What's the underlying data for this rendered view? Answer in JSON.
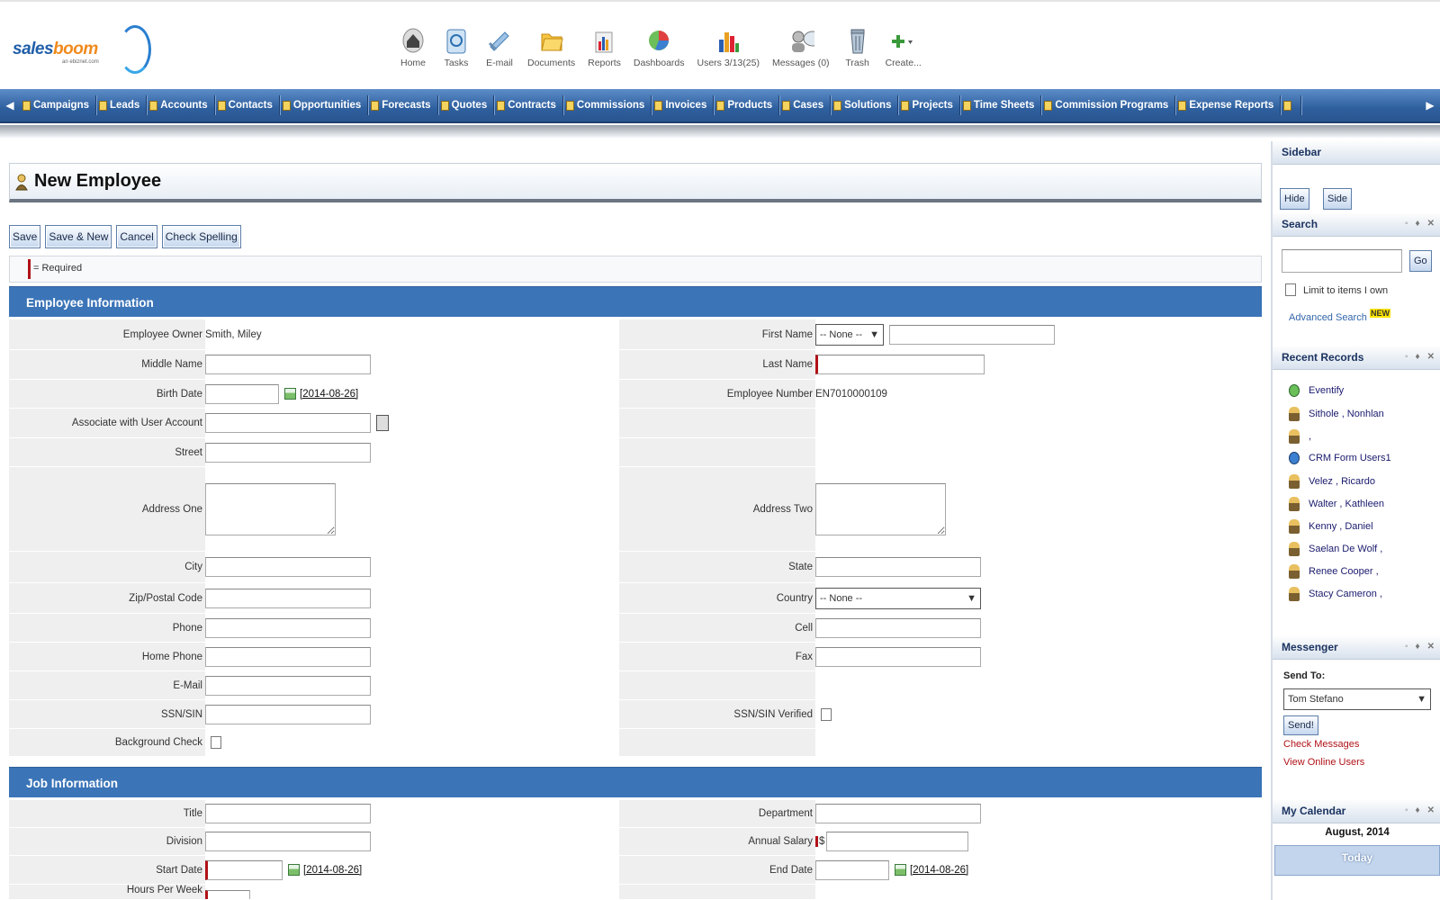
{
  "app": {
    "logo_main": "sales",
    "logo_accent": "boom",
    "logo_tagline": "an ebiznet.com"
  },
  "top_icons": [
    {
      "label": "Home",
      "icon": "home-icon"
    },
    {
      "label": "Tasks",
      "icon": "tasks-icon"
    },
    {
      "label": "E-mail",
      "icon": "email-icon"
    },
    {
      "label": "Documents",
      "icon": "folder-icon"
    },
    {
      "label": "Reports",
      "icon": "reports-icon"
    },
    {
      "label": "Dashboards",
      "icon": "dashboard-icon"
    },
    {
      "label": "Users 3/13(25)",
      "icon": "users-icon"
    },
    {
      "label": "Messages (0)",
      "icon": "messages-icon"
    },
    {
      "label": "Trash",
      "icon": "trash-icon"
    },
    {
      "label": "Create...",
      "icon": "create-icon"
    }
  ],
  "nav_tabs": [
    "Campaigns",
    "Leads",
    "Accounts",
    "Contacts",
    "Opportunities",
    "Forecasts",
    "Quotes",
    "Contracts",
    "Commissions",
    "Invoices",
    "Products",
    "Cases",
    "Solutions",
    "Projects",
    "Time Sheets",
    "Commission Programs",
    "Expense Reports"
  ],
  "page": {
    "title": "New Employee"
  },
  "buttons": {
    "save": "Save",
    "save_new": "Save & New",
    "cancel": "Cancel",
    "spell": "Check Spelling"
  },
  "required_note": "= Required",
  "sections": {
    "employee": "Employee Information",
    "job": "Job Information"
  },
  "labels": {
    "owner": "Employee Owner",
    "first_name": "First Name",
    "middle_name": "Middle Name",
    "last_name": "Last Name",
    "birth_date": "Birth Date",
    "employee_number": "Employee Number",
    "associate": "Associate with User Account",
    "street": "Street",
    "address_one": "Address One",
    "address_two": "Address Two",
    "city": "City",
    "state": "State",
    "zip": "Zip/Postal Code",
    "country": "Country",
    "phone": "Phone",
    "cell": "Cell",
    "home_phone": "Home Phone",
    "fax": "Fax",
    "email": "E-Mail",
    "ssn": "SSN/SIN",
    "ssn_verified": "SSN/SIN Verified",
    "background": "Background Check",
    "title": "Title",
    "department": "Department",
    "division": "Division",
    "salary": "Annual Salary",
    "start_date": "Start Date",
    "end_date": "End Date",
    "hours": "Hours Per Week"
  },
  "values": {
    "owner": "Smith, Miley",
    "salutation": "-- None --",
    "employee_number": "EN7010000109",
    "country": "-- None --",
    "birth_date_link": "[2014-08-26]",
    "start_date_link": "[2014-08-26]",
    "end_date_link": "[2014-08-26]",
    "salary_currency": "$"
  },
  "sidebar": {
    "title": "Sidebar",
    "hide": "Hide",
    "side": "Side",
    "search": {
      "title": "Search",
      "go": "Go",
      "limit": "Limit to items I own",
      "advanced": "Advanced Search",
      "new_badge": "NEW"
    },
    "recent": {
      "title": "Recent Records",
      "items": [
        "Eventify",
        "Sithole , Nonhlan",
        ",",
        "CRM Form Users1",
        "Velez , Ricardo",
        "Walter , Kathleen",
        "Kenny , Daniel",
        "Saelan De Wolf ,",
        "Renee Cooper ,",
        "Stacy Cameron ,"
      ]
    },
    "messenger": {
      "title": "Messenger",
      "send_to": "Send To:",
      "recipient": "Tom Stefano",
      "send": "Send!",
      "check": "Check Messages",
      "online": "View Online Users"
    },
    "calendar": {
      "title": "My Calendar",
      "month": "August, 2014",
      "today": "Today"
    }
  },
  "colors": {
    "nav": "#2e5f9e",
    "section": "#3b74b7",
    "required": "#b01218"
  }
}
